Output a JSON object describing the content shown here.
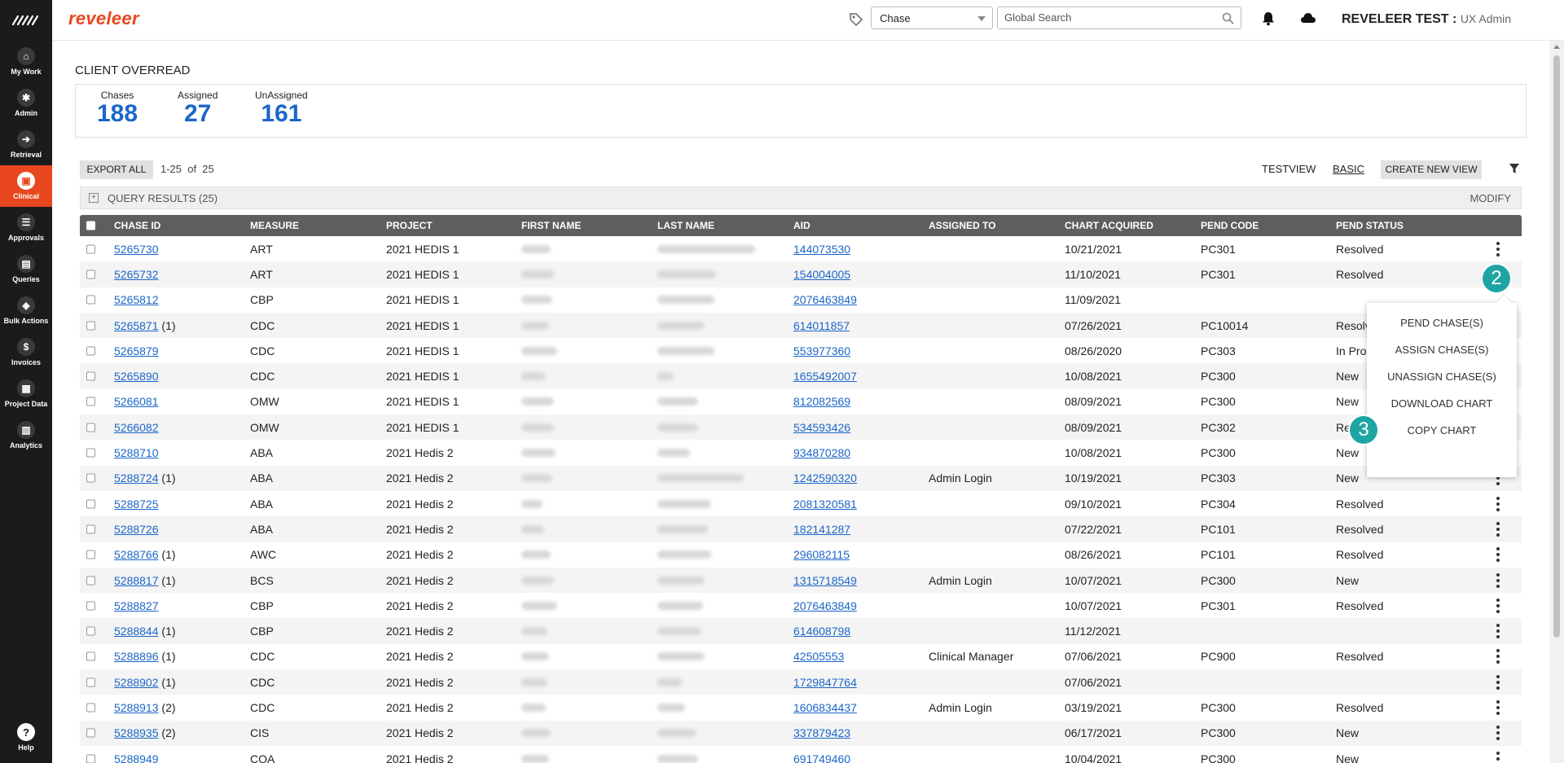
{
  "brand": "reveleer",
  "nav": {
    "items": [
      {
        "label": "My Work",
        "icon": "home-icon"
      },
      {
        "label": "Admin",
        "icon": "gear-icon"
      },
      {
        "label": "Retrieval",
        "icon": "arrow-right-icon"
      },
      {
        "label": "Clinical",
        "icon": "clipboard-icon"
      },
      {
        "label": "Approvals",
        "icon": "list-check-icon"
      },
      {
        "label": "Queries",
        "icon": "document-icon"
      },
      {
        "label": "Bulk Actions",
        "icon": "layers-icon"
      },
      {
        "label": "Invoices",
        "icon": "dollar-icon"
      },
      {
        "label": "Project Data",
        "icon": "grid-icon"
      },
      {
        "label": "Analytics",
        "icon": "bar-chart-icon"
      }
    ],
    "active": "Clinical",
    "help": "Help"
  },
  "header": {
    "select_value": "Chase",
    "search_placeholder": "Global Search",
    "user_name": "REVELEER TEST :",
    "user_role": "UX Admin"
  },
  "page": {
    "title": "CLIENT OVERREAD",
    "stats": {
      "chases_label": "Chases",
      "chases_value": "188",
      "assigned_label": "Assigned",
      "assigned_value": "27",
      "unassigned_label": "UnAssigned",
      "unassigned_value": "161"
    },
    "export_label": "EXPORT ALL",
    "paging": "1-25  of  25",
    "view_test": "TESTVIEW",
    "view_basic": "BASIC",
    "create_view_label": "CREATE NEW VIEW",
    "query_results": "QUERY RESULTS (25)",
    "modify": "MODIFY"
  },
  "table": {
    "columns": [
      "CHASE ID",
      "MEASURE",
      "PROJECT",
      "FIRST NAME",
      "LAST NAME",
      "AID",
      "ASSIGNED TO",
      "CHART ACQUIRED",
      "PEND CODE",
      "PEND STATUS"
    ],
    "rows": [
      {
        "id": "5265730",
        "count": "",
        "measure": "ART",
        "project": "2021 HEDIS 1",
        "aid": "144073530",
        "assigned": "",
        "acquired": "10/21/2021",
        "pend": "PC301",
        "status": "Resolved"
      },
      {
        "id": "5265732",
        "count": "",
        "measure": "ART",
        "project": "2021 HEDIS 1",
        "aid": "154004005",
        "assigned": "",
        "acquired": "11/10/2021",
        "pend": "PC301",
        "status": "Resolved"
      },
      {
        "id": "5265812",
        "count": "",
        "measure": "CBP",
        "project": "2021 HEDIS 1",
        "aid": "2076463849",
        "assigned": "",
        "acquired": "11/09/2021",
        "pend": "",
        "status": ""
      },
      {
        "id": "5265871",
        "count": "(1)",
        "measure": "CDC",
        "project": "2021 HEDIS 1",
        "aid": "614011857",
        "assigned": "",
        "acquired": "07/26/2021",
        "pend": "PC10014",
        "status": "Resolv"
      },
      {
        "id": "5265879",
        "count": "",
        "measure": "CDC",
        "project": "2021 HEDIS 1",
        "aid": "553977360",
        "assigned": "",
        "acquired": "08/26/2020",
        "pend": "PC303",
        "status": "In Proc"
      },
      {
        "id": "5265890",
        "count": "",
        "measure": "CDC",
        "project": "2021 HEDIS 1",
        "aid": "1655492007",
        "assigned": "",
        "acquired": "10/08/2021",
        "pend": "PC300",
        "status": "New"
      },
      {
        "id": "5266081",
        "count": "",
        "measure": "OMW",
        "project": "2021 HEDIS 1",
        "aid": "812082569",
        "assigned": "",
        "acquired": "08/09/2021",
        "pend": "PC300",
        "status": "New"
      },
      {
        "id": "5266082",
        "count": "",
        "measure": "OMW",
        "project": "2021 HEDIS 1",
        "aid": "534593426",
        "assigned": "",
        "acquired": "08/09/2021",
        "pend": "PC302",
        "status": "Re"
      },
      {
        "id": "5288710",
        "count": "",
        "measure": "ABA",
        "project": "2021 Hedis 2",
        "aid": "934870280",
        "assigned": "",
        "acquired": "10/08/2021",
        "pend": "PC300",
        "status": "New"
      },
      {
        "id": "5288724",
        "count": "(1)",
        "measure": "ABA",
        "project": "2021 Hedis 2",
        "aid": "1242590320",
        "assigned": "Admin Login",
        "acquired": "10/19/2021",
        "pend": "PC303",
        "status": "New"
      },
      {
        "id": "5288725",
        "count": "",
        "measure": "ABA",
        "project": "2021 Hedis 2",
        "aid": "2081320581",
        "assigned": "",
        "acquired": "09/10/2021",
        "pend": "PC304",
        "status": "Resolved"
      },
      {
        "id": "5288726",
        "count": "",
        "measure": "ABA",
        "project": "2021 Hedis 2",
        "aid": "182141287",
        "assigned": "",
        "acquired": "07/22/2021",
        "pend": "PC101",
        "status": "Resolved"
      },
      {
        "id": "5288766",
        "count": "(1)",
        "measure": "AWC",
        "project": "2021 Hedis 2",
        "aid": "296082115",
        "assigned": "",
        "acquired": "08/26/2021",
        "pend": "PC101",
        "status": "Resolved"
      },
      {
        "id": "5288817",
        "count": "(1)",
        "measure": "BCS",
        "project": "2021 Hedis 2",
        "aid": "1315718549",
        "assigned": "Admin Login",
        "acquired": "10/07/2021",
        "pend": "PC300",
        "status": "New"
      },
      {
        "id": "5288827",
        "count": "",
        "measure": "CBP",
        "project": "2021 Hedis 2",
        "aid": "2076463849",
        "assigned": "",
        "acquired": "10/07/2021",
        "pend": "PC301",
        "status": "Resolved"
      },
      {
        "id": "5288844",
        "count": "(1)",
        "measure": "CBP",
        "project": "2021 Hedis 2",
        "aid": "614608798",
        "assigned": "",
        "acquired": "11/12/2021",
        "pend": "",
        "status": ""
      },
      {
        "id": "5288896",
        "count": "(1)",
        "measure": "CDC",
        "project": "2021 Hedis 2",
        "aid": "42505553",
        "assigned": "Clinical Manager",
        "acquired": "07/06/2021",
        "pend": "PC900",
        "status": "Resolved"
      },
      {
        "id": "5288902",
        "count": "(1)",
        "measure": "CDC",
        "project": "2021 Hedis 2",
        "aid": "1729847764",
        "assigned": "",
        "acquired": "07/06/2021",
        "pend": "",
        "status": ""
      },
      {
        "id": "5288913",
        "count": "(2)",
        "measure": "CDC",
        "project": "2021 Hedis 2",
        "aid": "1606834437",
        "assigned": "Admin Login",
        "acquired": "03/19/2021",
        "pend": "PC300",
        "status": "Resolved"
      },
      {
        "id": "5288935",
        "count": "(2)",
        "measure": "CIS",
        "project": "2021 Hedis 2",
        "aid": "337879423",
        "assigned": "",
        "acquired": "06/17/2021",
        "pend": "PC300",
        "status": "New"
      },
      {
        "id": "5288949",
        "count": "",
        "measure": "COA",
        "project": "2021 Hedis 2",
        "aid": "691749460",
        "assigned": "",
        "acquired": "10/04/2021",
        "pend": "PC300",
        "status": "New"
      }
    ]
  },
  "menu": {
    "items": [
      "PEND CHASE(S)",
      "ASSIGN CHASE(S)",
      "UNASSIGN CHASE(S)",
      "DOWNLOAD CHART",
      "COPY CHART"
    ]
  },
  "badges": {
    "two": "2",
    "three": "3"
  },
  "colors": {
    "accent": "#e8461e",
    "link": "#1b66c9",
    "badge": "#1fa4a4",
    "header": "#5e5e5e"
  }
}
